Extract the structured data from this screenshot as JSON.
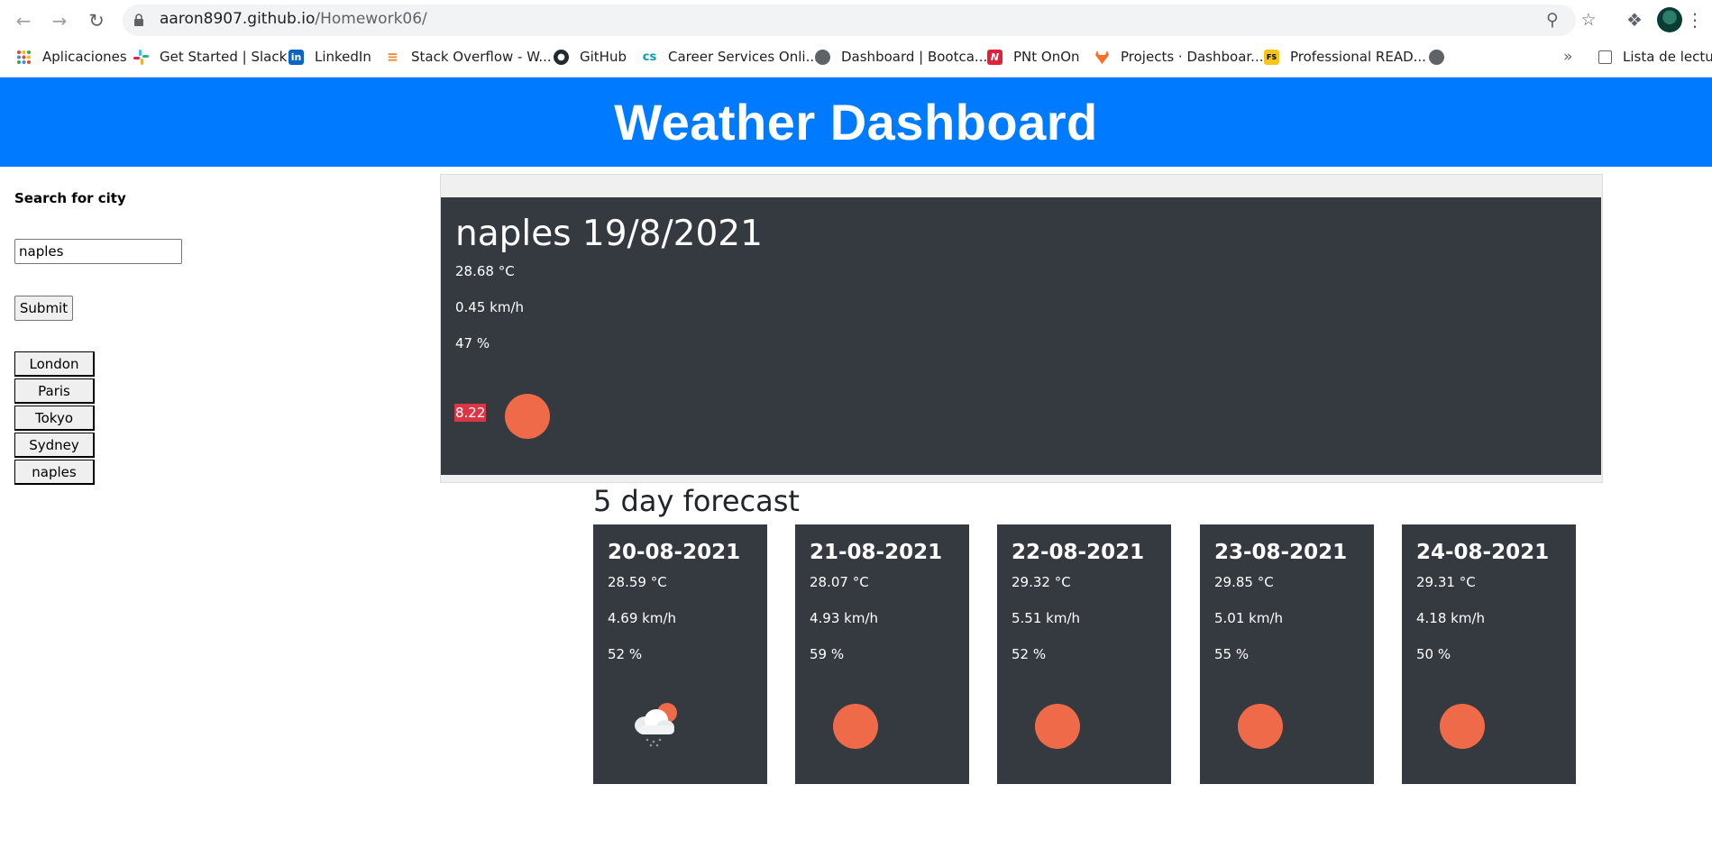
{
  "browser": {
    "url_host": "aaron8907.github.io",
    "url_path": "/Homework06/",
    "bookmarks": [
      {
        "label": "Aplicaciones",
        "icon": "apps-grid-icon"
      },
      {
        "label": "Get Started | Slack",
        "icon": "slack-icon"
      },
      {
        "label": "LinkedIn",
        "icon": "linkedin-icon"
      },
      {
        "label": "Stack Overflow - W...",
        "icon": "stackoverflow-icon"
      },
      {
        "label": "GitHub",
        "icon": "github-icon"
      },
      {
        "label": "Career Services Onli...",
        "icon": "cs-icon"
      },
      {
        "label": "Dashboard | Bootca...",
        "icon": "globe-icon"
      },
      {
        "label": "PNt OnOn",
        "icon": "pnt-icon"
      },
      {
        "label": "Projects · Dashboar...",
        "icon": "gitlab-icon"
      },
      {
        "label": "Professional READ...",
        "icon": "fs-icon"
      }
    ],
    "overflow_label": "»",
    "reading_list_label": "Lista de lectura"
  },
  "header": {
    "title": "Weather Dashboard"
  },
  "search": {
    "label": "Search for city",
    "input_value": "naples",
    "submit_label": "Submit",
    "history": [
      "London",
      "Paris",
      "Tokyo",
      "Sydney",
      "naples"
    ]
  },
  "current": {
    "title": "naples 19/8/2021",
    "temp": "28.68 °C",
    "wind": "0.45 km/h",
    "humidity": "47 %",
    "uv": "8.22",
    "icon": "sun-icon"
  },
  "forecast": {
    "heading": "5 day forecast",
    "days": [
      {
        "date": "20-08-2021",
        "temp": "28.59 °C",
        "wind": "4.69 km/h",
        "humidity": "52 %",
        "icon": "cloud-rain-sun-icon"
      },
      {
        "date": "21-08-2021",
        "temp": "28.07 °C",
        "wind": "4.93 km/h",
        "humidity": "59 %",
        "icon": "sun-icon"
      },
      {
        "date": "22-08-2021",
        "temp": "29.32 °C",
        "wind": "5.51 km/h",
        "humidity": "52 %",
        "icon": "sun-icon"
      },
      {
        "date": "23-08-2021",
        "temp": "29.85 °C",
        "wind": "5.01 km/h",
        "humidity": "55 %",
        "icon": "sun-icon"
      },
      {
        "date": "24-08-2021",
        "temp": "29.31 °C",
        "wind": "4.18 km/h",
        "humidity": "50 %",
        "icon": "sun-icon"
      }
    ]
  },
  "colors": {
    "header_bg": "#007bff",
    "card_bg": "#343a40",
    "uv_badge": "#dc3545",
    "sun": "#ee6a48"
  }
}
